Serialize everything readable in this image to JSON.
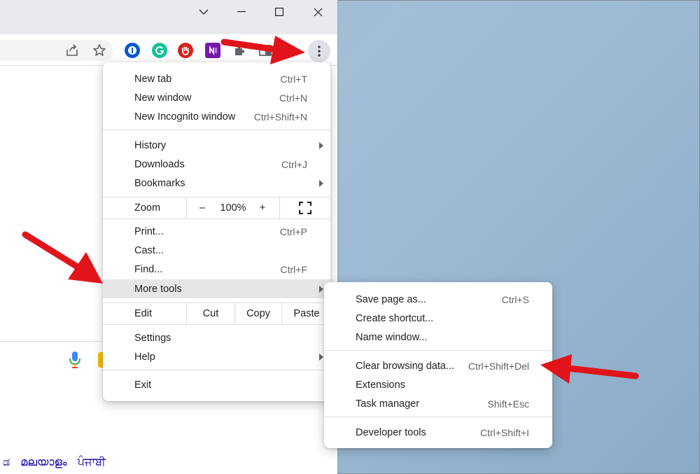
{
  "window": {
    "controls": [
      "chevron-down-icon",
      "minimize-icon",
      "maximize-icon",
      "close-icon"
    ]
  },
  "toolbar": {
    "icons": [
      "share-icon",
      "star-icon",
      "1password-icon",
      "grammarly-icon",
      "adblock-icon",
      "onenote-icon",
      "extensions-icon",
      "sidepanel-icon",
      "more-menu-icon"
    ]
  },
  "menu": {
    "new_tab": {
      "label": "New tab",
      "shortcut": "Ctrl+T"
    },
    "new_window": {
      "label": "New window",
      "shortcut": "Ctrl+N"
    },
    "new_incognito": {
      "label": "New Incognito window",
      "shortcut": "Ctrl+Shift+N"
    },
    "history": {
      "label": "History"
    },
    "downloads": {
      "label": "Downloads",
      "shortcut": "Ctrl+J"
    },
    "bookmarks": {
      "label": "Bookmarks"
    },
    "zoom": {
      "label": "Zoom",
      "minus": "–",
      "value": "100%",
      "plus": "+"
    },
    "print": {
      "label": "Print...",
      "shortcut": "Ctrl+P"
    },
    "cast": {
      "label": "Cast..."
    },
    "find": {
      "label": "Find...",
      "shortcut": "Ctrl+F"
    },
    "more_tools": {
      "label": "More tools"
    },
    "edit": {
      "label": "Edit",
      "cut": "Cut",
      "copy": "Copy",
      "paste": "Paste"
    },
    "settings": {
      "label": "Settings"
    },
    "help": {
      "label": "Help"
    },
    "exit": {
      "label": "Exit"
    }
  },
  "submenu": {
    "save_page": {
      "label": "Save page as...",
      "shortcut": "Ctrl+S"
    },
    "create_shortcut": {
      "label": "Create shortcut..."
    },
    "name_window": {
      "label": "Name window..."
    },
    "clear_browsing": {
      "label": "Clear browsing data...",
      "shortcut": "Ctrl+Shift+Del"
    },
    "extensions": {
      "label": "Extensions"
    },
    "task_manager": {
      "label": "Task manager",
      "shortcut": "Shift+Esc"
    },
    "dev_tools": {
      "label": "Developer tools",
      "shortcut": "Ctrl+Shift+I"
    }
  },
  "page": {
    "languages": [
      "ಡ",
      "മലയാളം",
      "ਪੰਜਾਬੀ"
    ]
  },
  "colors": {
    "arrow": "#e0141a",
    "menu_highlight": "#e6e6e6",
    "desktop": "#9cb9d3"
  }
}
